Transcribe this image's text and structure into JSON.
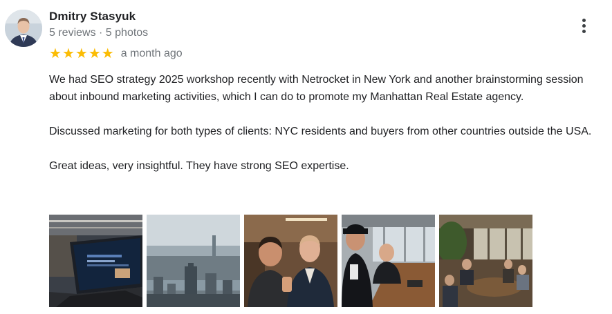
{
  "reviewer": {
    "name": "Dmitry Stasyuk",
    "meta": "5 reviews · 5 photos",
    "avatar_icon": "person-avatar"
  },
  "rating": {
    "stars": 5,
    "max_stars": 5,
    "star_color": "#fbbc04",
    "date": "a month ago"
  },
  "review": {
    "paragraphs": [
      "We had SEO strategy 2025 workshop recently with Netrocket in New York and another brainstorming session about inbound marketing activities, which I can do to promote my Manhattan Real Estate agency.",
      "Discussed marketing for both types of clients: NYC residents and buyers from other countries outside the USA.",
      "Great ideas, very insightful. They have strong SEO expertise."
    ]
  },
  "actions": {
    "more_icon": "more-vert-icon"
  },
  "photos": [
    {
      "subject": "laptop-presentation-photo"
    },
    {
      "subject": "city-skyline-photo"
    },
    {
      "subject": "two-men-selfie-photo"
    },
    {
      "subject": "office-meeting-photo"
    },
    {
      "subject": "lounge-group-photo"
    }
  ]
}
